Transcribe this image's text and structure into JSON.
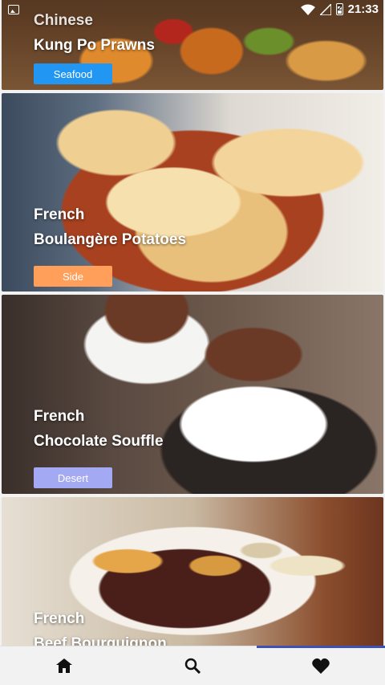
{
  "status_bar": {
    "time": "21:33",
    "battery_label": "2",
    "icons": [
      "image-icon",
      "wifi-icon",
      "signal-icon",
      "battery-icon"
    ]
  },
  "recipes": [
    {
      "cuisine": "Chinese",
      "name": "Kung Po Prawns",
      "category": "Seafood",
      "category_color": "#2196f3"
    },
    {
      "cuisine": "French",
      "name": "Boulangère Potatoes",
      "category": "Side",
      "category_color": "#ff9f5a"
    },
    {
      "cuisine": "French",
      "name": "Chocolate Souffle",
      "category": "Desert",
      "category_color": "#a3a9f2"
    },
    {
      "cuisine": "French",
      "name": "Beef Bourguignon",
      "category": "",
      "category_color": ""
    }
  ],
  "bottom_nav": {
    "items": [
      {
        "icon": "home-icon",
        "active": false
      },
      {
        "icon": "search-icon",
        "active": false
      },
      {
        "icon": "heart-icon",
        "active": true
      }
    ],
    "accent_color": "#3f51b5"
  }
}
